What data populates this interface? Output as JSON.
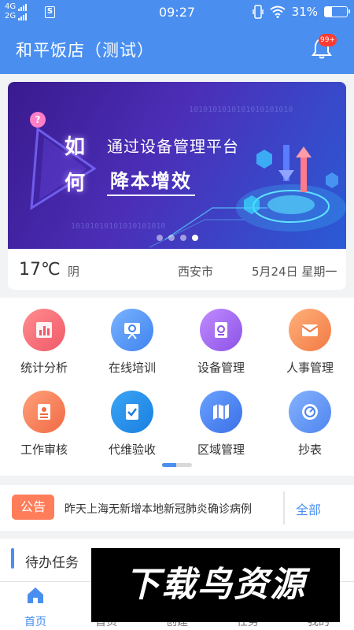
{
  "status_bar": {
    "network_top": "4G",
    "network_bottom": "2G",
    "time": "09:27",
    "battery": "31%",
    "battery_level": 0.31
  },
  "header": {
    "title": "和平饭店（测试）",
    "badge": "99+"
  },
  "banner": {
    "text_ru": "如",
    "text_he": "何",
    "line1": "通过设备管理平台",
    "line2": "降本增效",
    "binary_top": "1010101010101010101010",
    "binary_bottom": "10101010101010101010",
    "dots": 4,
    "active_dot": 3
  },
  "weather": {
    "temp": "17℃",
    "desc": "阴",
    "city": "西安市",
    "date": "5月24日 星期一"
  },
  "menu": [
    {
      "label": "统计分析",
      "icon": "stats-icon",
      "color": "#f2676c"
    },
    {
      "label": "在线培训",
      "icon": "training-icon",
      "color": "#4a8ff0"
    },
    {
      "label": "设备管理",
      "icon": "device-icon",
      "color": "#a062e8"
    },
    {
      "label": "人事管理",
      "icon": "hr-icon",
      "color": "#f6935a"
    },
    {
      "label": "工作审核",
      "icon": "audit-icon",
      "color": "#f4855a"
    },
    {
      "label": "代维验收",
      "icon": "acceptance-icon",
      "color": "#2f9af2"
    },
    {
      "label": "区域管理",
      "icon": "area-icon",
      "color": "#4a7ff0"
    },
    {
      "label": "抄表",
      "icon": "meter-icon",
      "color": "#5c97f0"
    }
  ],
  "notice": {
    "badge": "公告",
    "text": "昨天上海无新增本地新冠肺炎确诊病例",
    "all": "全部"
  },
  "todo": {
    "title": "待办任务"
  },
  "tabs": [
    {
      "label": "首页",
      "icon": "home-icon",
      "active": true
    },
    {
      "label": "首页",
      "icon": "tab2-icon",
      "active": false
    },
    {
      "label": "创建",
      "icon": "create-icon",
      "active": false
    },
    {
      "label": "任务",
      "icon": "task-icon",
      "active": false
    },
    {
      "label": "我的",
      "icon": "profile-icon",
      "active": false
    }
  ],
  "tab_labels_visible": [
    "首页",
    "首页",
    "创建",
    "任务",
    "我的"
  ],
  "watermark": "下载鸟资源",
  "colors": {
    "primary": "#4a8ff0",
    "notice_badge": "#ff7d5a",
    "badge_red": "#ff3b30"
  }
}
